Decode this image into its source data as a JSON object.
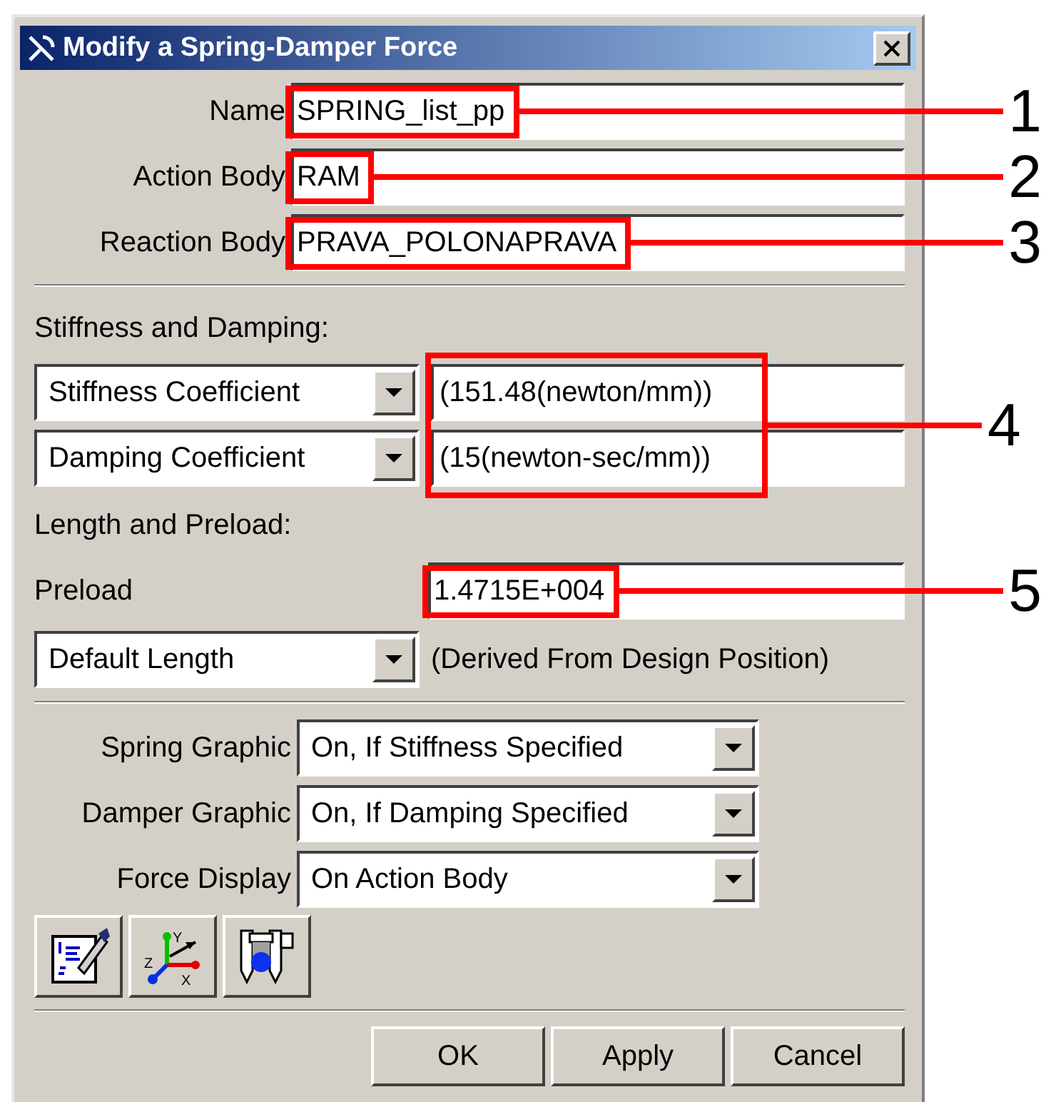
{
  "window": {
    "title": "Modify a Spring-Damper Force"
  },
  "fields": [
    {
      "label": "Name",
      "value": "SPRING_list_pp",
      "callout": "1"
    },
    {
      "label": "Action Body",
      "value": "RAM",
      "callout": "2"
    },
    {
      "label": "Reaction Body",
      "value": "PRAVA_POLONAPRAVA",
      "callout": "3"
    }
  ],
  "stiffness_section": {
    "heading": "Stiffness and Damping:",
    "callout": "4",
    "rows": [
      {
        "option": "Stiffness Coefficient",
        "value": "(151.48(newton/mm))"
      },
      {
        "option": "Damping Coefficient",
        "value": "(15(newton-sec/mm))"
      }
    ]
  },
  "length_section": {
    "heading": "Length and Preload:",
    "preload": {
      "label": "Preload",
      "value": "1.4715E+004",
      "callout": "5"
    },
    "length_option": "Default Length",
    "length_note": "(Derived From Design Position)"
  },
  "graphics": [
    {
      "label": "Spring Graphic",
      "option": "On, If Stiffness Specified"
    },
    {
      "label": "Damper Graphic",
      "option": "On, If Damping Specified"
    },
    {
      "label": "Force Display",
      "option": "On Action Body"
    }
  ],
  "tool_buttons": [
    {
      "kind": "notes"
    },
    {
      "kind": "axes",
      "labels": [
        "Y",
        "Z",
        "X"
      ]
    },
    {
      "kind": "gauge"
    }
  ],
  "buttons": [
    "OK",
    "Apply",
    "Cancel"
  ]
}
